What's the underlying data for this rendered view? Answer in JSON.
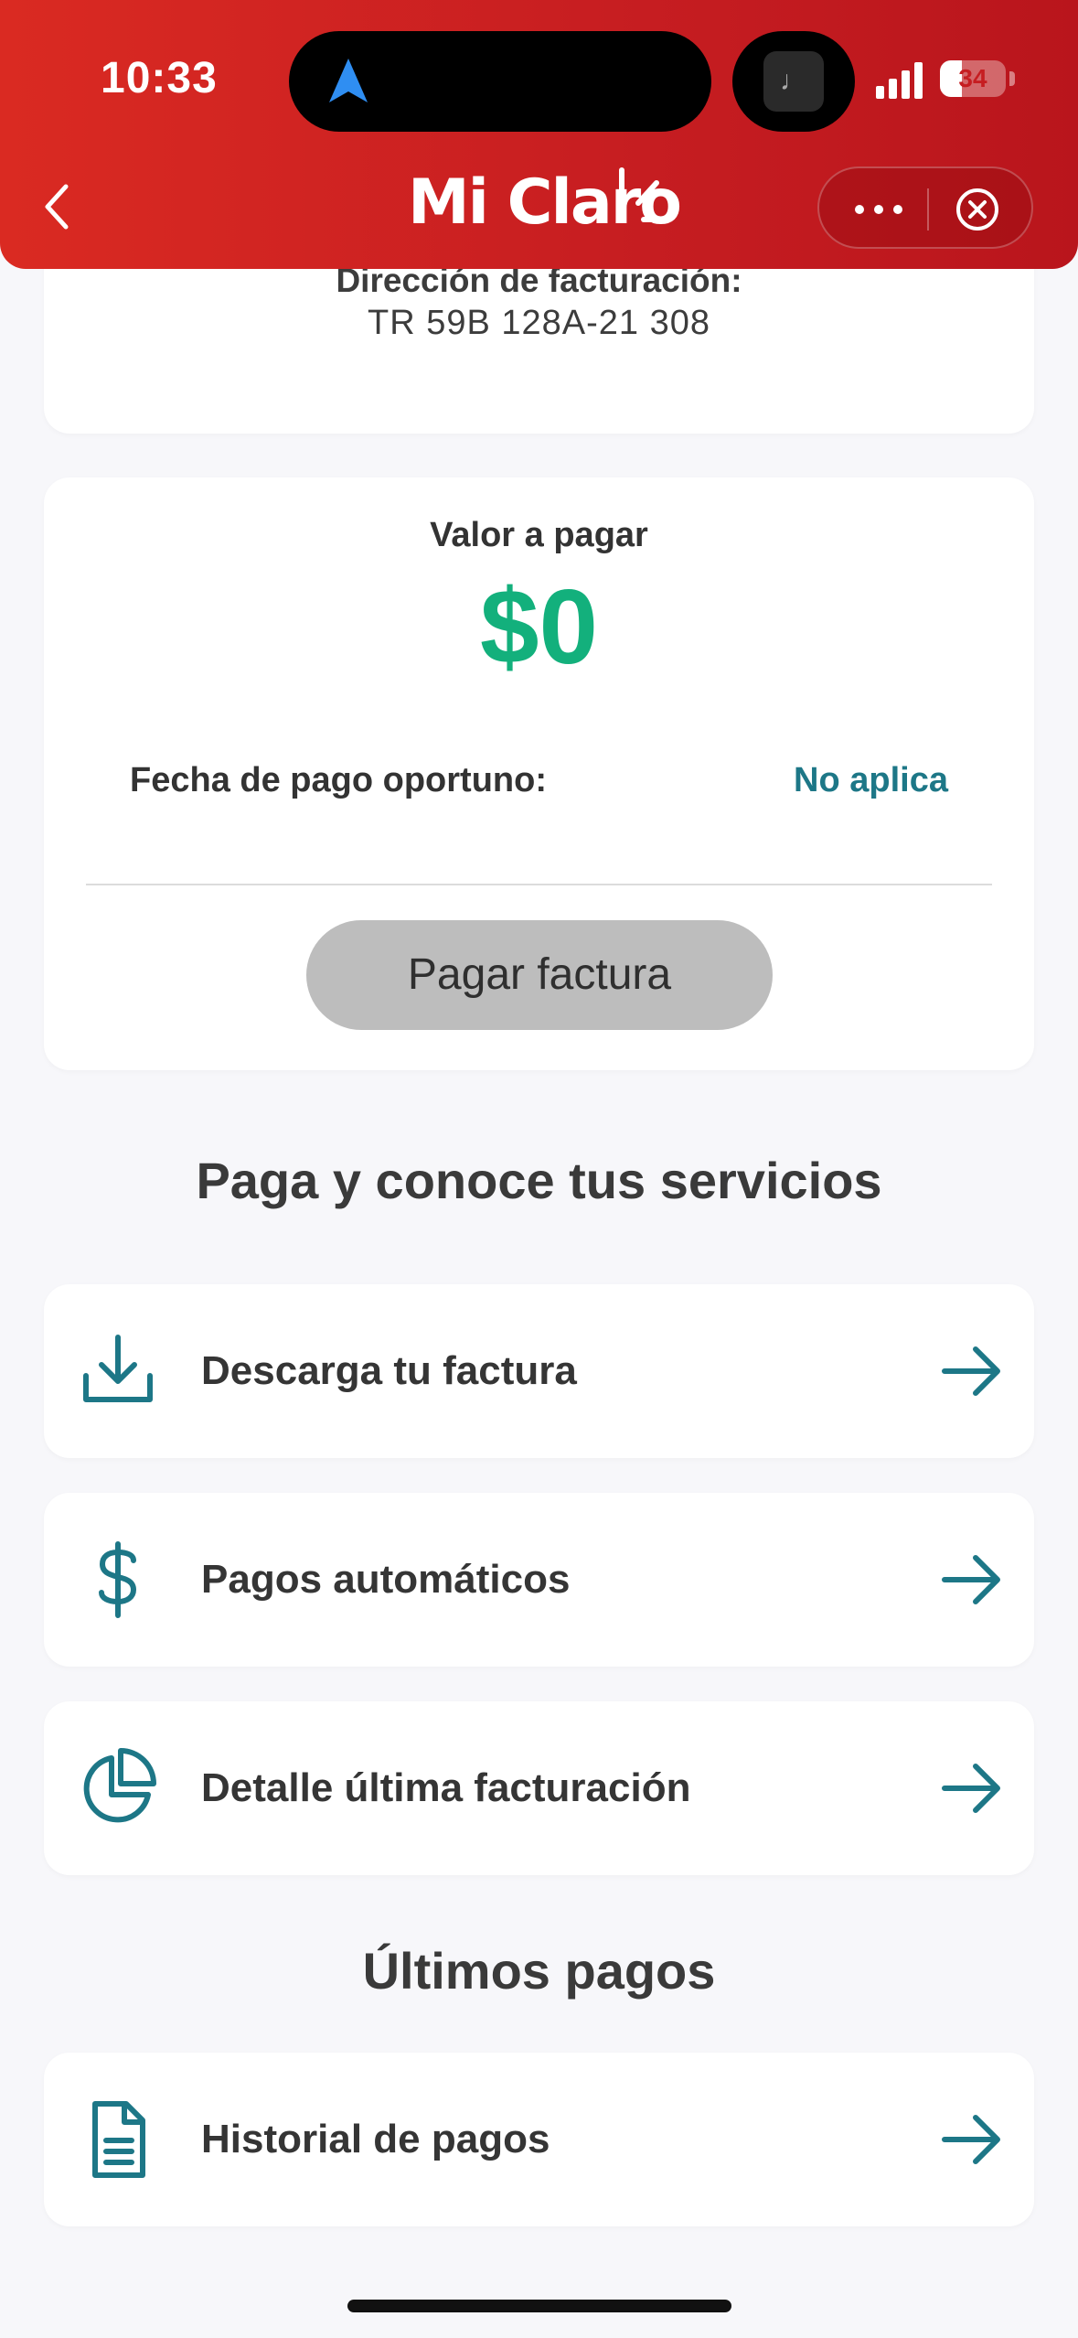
{
  "status_bar": {
    "time": "10:33",
    "battery": "34"
  },
  "header": {
    "brand": "Mi Claro"
  },
  "billing_address": {
    "label": "Dirección de facturación:",
    "value": "TR 59B 128A-21 308"
  },
  "payment": {
    "label": "Valor a pagar",
    "amount": "$0",
    "due_label": "Fecha de pago oportuno:",
    "due_value": "No aplica",
    "button_label": "Pagar factura"
  },
  "services": {
    "title": "Paga y conoce tus servicios",
    "items": [
      {
        "label": "Descarga tu factura",
        "icon": "download-icon"
      },
      {
        "label": "Pagos automáticos",
        "icon": "dollar-icon"
      },
      {
        "label": "Detalle última facturación",
        "icon": "pie-chart-icon"
      }
    ]
  },
  "last_payments": {
    "title": "Últimos pagos",
    "items": [
      {
        "label": "Historial de pagos",
        "icon": "document-icon"
      }
    ]
  },
  "colors": {
    "header_red": "#c61d21",
    "amount_green": "#13b07c",
    "accent_teal": "#1d7787",
    "button_disabled": "#bdbdbd"
  }
}
